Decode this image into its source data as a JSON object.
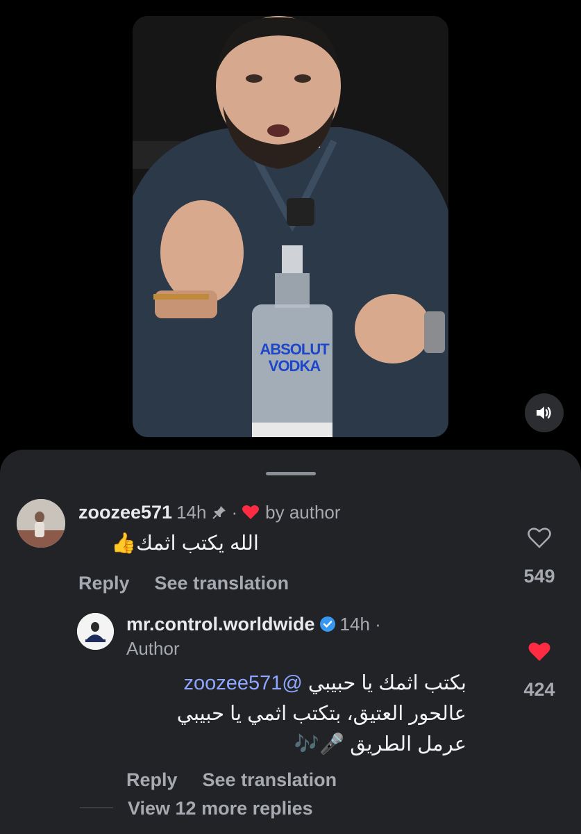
{
  "comments": [
    {
      "username": "zoozee571",
      "time": "14h",
      "separator": "·",
      "badge": "by author",
      "text": "الله يكتب اثمك👍",
      "reply_label": "Reply",
      "translate_label": "See translation",
      "likes": "549"
    }
  ],
  "reply": {
    "username": "mr.control.worldwide",
    "time": "14h ·",
    "role": "Author",
    "line1_text": "بكتب اثمك يا حبيبي",
    "mention": "@zoozee571",
    "line2": "عالحور العتيق، بتكتب اثمي يا حبيبي",
    "line3": "عرمل الطريق 🎤🎶",
    "reply_label": "Reply",
    "translate_label": "See translation",
    "likes": "424"
  },
  "more_replies": "View 12 more replies",
  "video": {
    "bottle_brand": "ABSOLUT",
    "bottle_type": "VODKA"
  },
  "colors": {
    "sheet_bg": "#222327",
    "heart_red": "#ff2b42",
    "mention_blue": "#8ea6ff",
    "verified_blue": "#3897f0"
  }
}
